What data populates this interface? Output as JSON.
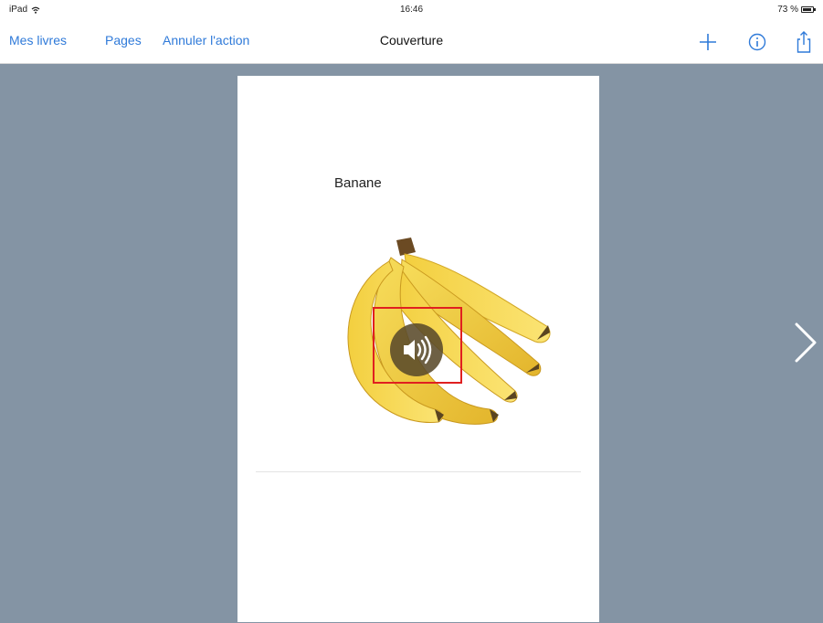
{
  "status_bar": {
    "device": "iPad",
    "time": "16:46",
    "battery": "73 %"
  },
  "navbar": {
    "my_books": "Mes livres",
    "pages": "Pages",
    "undo": "Annuler l'action",
    "title": "Couverture",
    "add_icon": "plus-icon",
    "info_icon": "info-icon",
    "share_icon": "share-icon",
    "accent_color": "#2f7ad9"
  },
  "page": {
    "title": "Banane",
    "image": "banana-bunch",
    "sound_icon": "speaker-icon",
    "background": "#8494a4"
  },
  "next_icon": "chevron-right-icon"
}
